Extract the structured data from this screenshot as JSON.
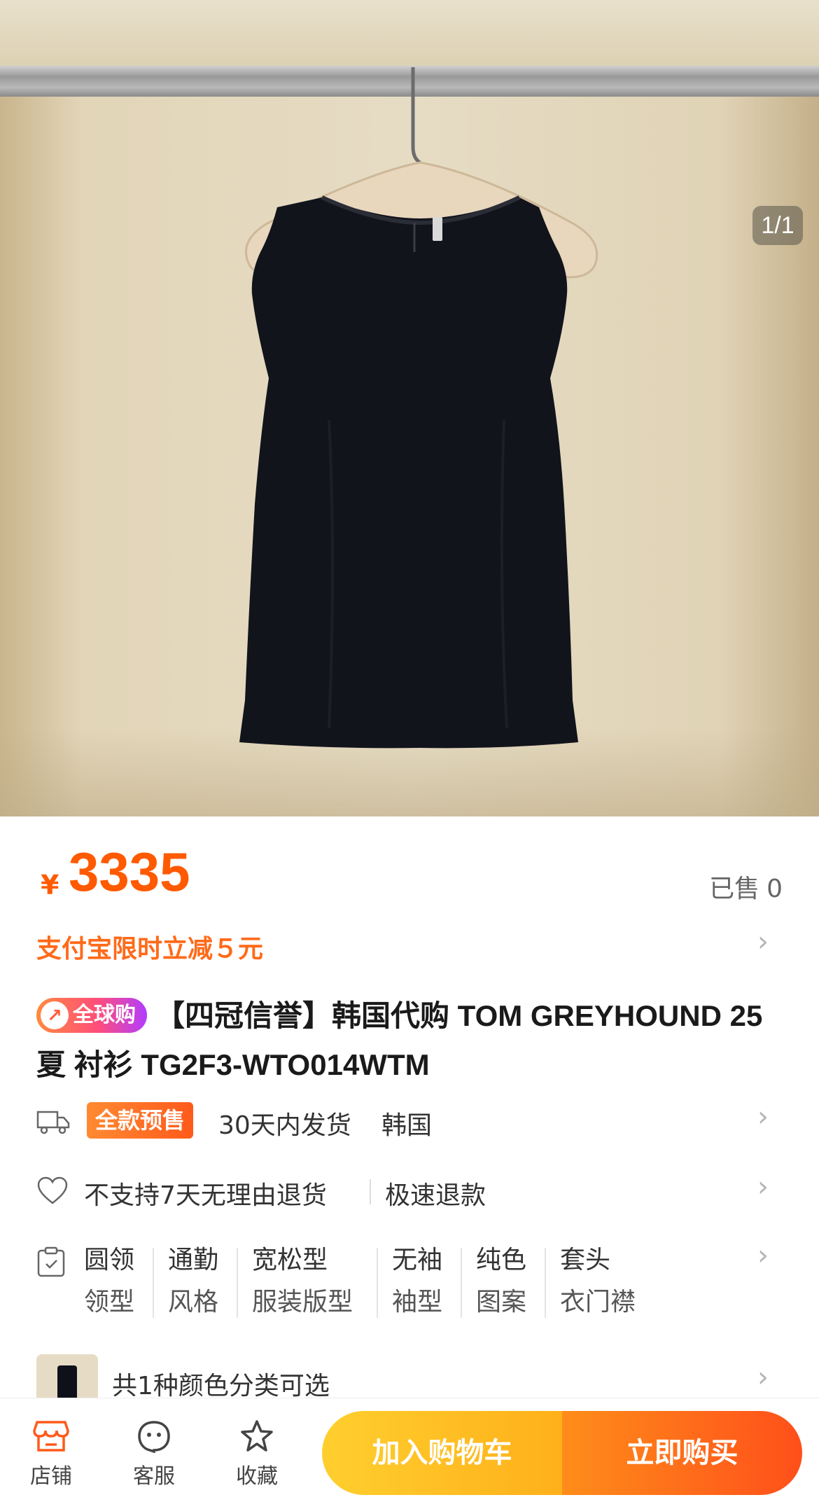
{
  "gallery": {
    "counter": "1/1"
  },
  "price": {
    "currency": "¥",
    "amount": "3335",
    "sold_label": "已售",
    "sold_count": "0"
  },
  "promo": {
    "text": "支付宝限时立减５元"
  },
  "title": {
    "badge": "全球购",
    "text": "【四冠信誉】韩国代购 TOM GREYHOUND 25夏 衬衫 TG2F3-WTO014WTM"
  },
  "shipping": {
    "badge": "全款预售",
    "text": "30天内发货",
    "origin": "韩国"
  },
  "returns": {
    "text": "不支持7天无理由退货",
    "fast_refund": "极速退款"
  },
  "attributes": [
    {
      "value": "圆领",
      "key": "领型"
    },
    {
      "value": "通勤",
      "key": "风格"
    },
    {
      "value": "宽松型",
      "key": "服装版型"
    },
    {
      "value": "无袖",
      "key": "袖型"
    },
    {
      "value": "纯色",
      "key": "图案"
    },
    {
      "value": "套头",
      "key": "衣门襟"
    }
  ],
  "sku": {
    "text": "共1种颜色分类可选"
  },
  "bottom_bar": {
    "shop": "店铺",
    "service": "客服",
    "favorite": "收藏",
    "add_to_cart": "加入购物车",
    "buy_now": "立即购买"
  },
  "colors": {
    "accent": "#ff5a00",
    "cart": "#ffb01a",
    "buy": "#ff4f1a",
    "garment": "#12141c"
  },
  "icons": [
    "truck-icon",
    "heart-icon",
    "clipboard-icon",
    "chevron-right-icon",
    "shop-icon",
    "service-icon",
    "star-icon"
  ]
}
